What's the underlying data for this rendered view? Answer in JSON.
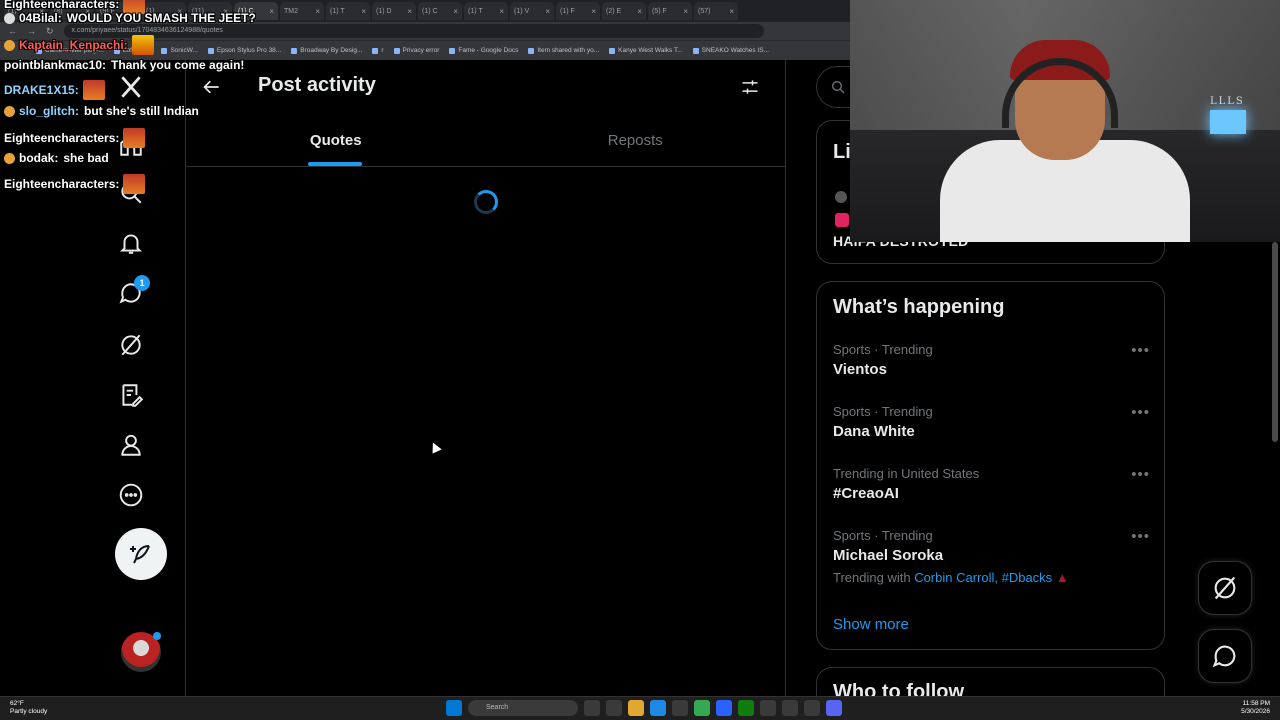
{
  "browser": {
    "tabs": [
      {
        "label": "(1)"
      },
      {
        "label": "(8)"
      },
      {
        "label": "(9) F"
      },
      {
        "label": "(1)"
      },
      {
        "label": "(11)"
      },
      {
        "label": "(1) C",
        "active": true
      },
      {
        "label": "TM2"
      },
      {
        "label": "(1) T"
      },
      {
        "label": "(1) D"
      },
      {
        "label": "(1) C"
      },
      {
        "label": "(1) T"
      },
      {
        "label": "(1) V"
      },
      {
        "label": "(1) F"
      },
      {
        "label": "(2) E"
      },
      {
        "label": "(5) F"
      },
      {
        "label": "(57)"
      }
    ],
    "url": "x.com/priyaee/status/1704834636124988/quotes",
    "bookmarks": [
      "Camera filter plug-...",
      "Lofi Mode",
      "SonicW...",
      "Epson Stylus Pro 38...",
      "Broadway By Desig...",
      "r",
      "Privacy error",
      "Fame - Google Docs",
      "Item shared with yo...",
      "Kanye West Walks T...",
      "SNEAKO Watches IS..."
    ]
  },
  "chat": [
    {
      "user": "Eighteencharacters:",
      "text": "",
      "emote": true
    },
    {
      "user": "04Bilal:",
      "text": "WOULD YOU SMASH THE JEET?",
      "badge": "white"
    },
    {
      "user": "Kaptain_Kenpachi:",
      "text": "",
      "emote": true,
      "color": "red",
      "badge": "gold"
    },
    {
      "user": "pointblankmac10:",
      "text": "Thank you come again!"
    },
    {
      "user": "DRAKE1X15:",
      "text": "",
      "emote": true,
      "color": "blue"
    },
    {
      "user": "slo_glitch:",
      "text": "but she's still Indian",
      "color": "cyan",
      "badge": "gold"
    },
    {
      "user": "Eighteencharacters:",
      "text": "",
      "emote": true
    },
    {
      "user": "bodak:",
      "text": "she bad",
      "badge": "gold"
    },
    {
      "user": "Eighteencharacters:",
      "text": "",
      "emote": true
    }
  ],
  "nav": {
    "messages_badge": "1"
  },
  "main": {
    "title": "Post activity",
    "tabs": [
      {
        "label": "Quotes",
        "selected": true
      },
      {
        "label": "Reposts",
        "selected": false
      }
    ]
  },
  "right": {
    "live_title": "Li",
    "live_item": "HAIFA DESTROYED",
    "whats_happening_heading": "What’s happening",
    "trends": [
      {
        "context": "Sports · Trending",
        "name": "Vientos"
      },
      {
        "context": "Sports · Trending",
        "name": "Dana White"
      },
      {
        "context": "Trending in United States",
        "name": "#CreaoAI"
      },
      {
        "context": "Sports · Trending",
        "name": "Michael Soroka",
        "with_label": "Trending with",
        "with_links": "Corbin Carroll, #Dbacks"
      }
    ],
    "show_more": "Show more",
    "who_to_follow": "Who to follow"
  },
  "webcam": {
    "shelf_text": "LLLS"
  },
  "taskbar": {
    "temp": "62°F",
    "weather": "Partly cloudy",
    "search_placeholder": "Search",
    "time": "11:58 PM",
    "date": "5/30/2026"
  },
  "colors": {
    "accent": "#1d9bf0",
    "background": "#000000",
    "border": "#2f3336",
    "muted_text": "#71767b"
  }
}
